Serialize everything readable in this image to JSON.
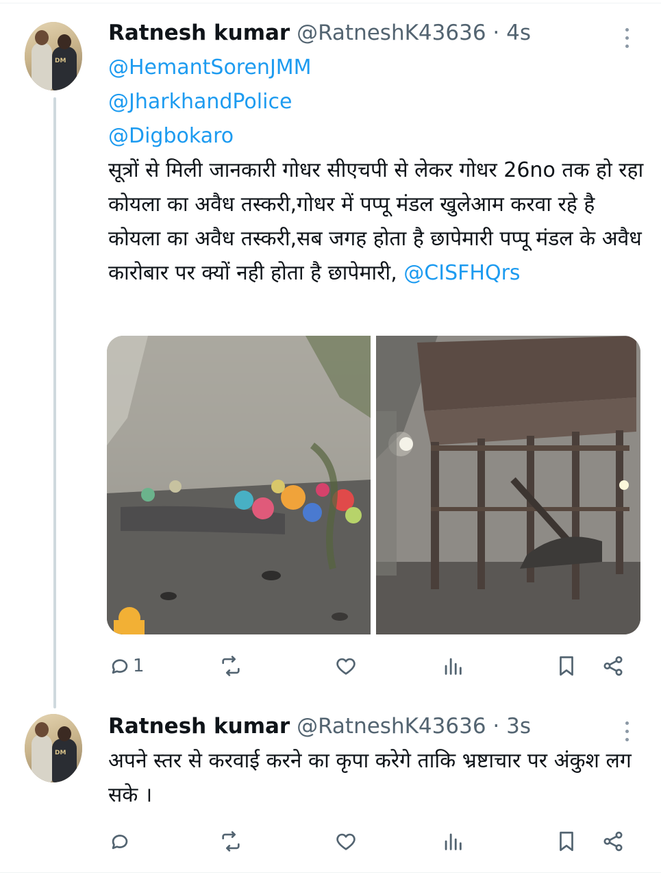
{
  "tweets": [
    {
      "name": "Ratnesh kumar",
      "handle": "@RatneshK43636",
      "time": "4s",
      "mentions": [
        "@HemantSorenJMM",
        "@JharkhandPolice",
        "@Digbokaro"
      ],
      "text": "सूत्रों से मिली जानकारी गोधर सीएचपी से लेकर गोधर 26no तक हो रहा कोयला का अवैध तस्करी,गोधर में पप्पू मंडल खुलेआम करवा रहे है कोयला का अवैध तस्करी,सब जगह होता है छापेमारी पप्पू मंडल के अवैध कारोबार पर क्यों नही होता है छापेमारी,",
      "trailing_mention": "@CISFHQrs",
      "reply_count": "1"
    },
    {
      "name": "Ratnesh kumar",
      "handle": "@RatneshK43636",
      "time": "3s",
      "text": "अपने स्तर से करवाई करने का कृपा करेगे ताकि भ्रष्टाचार पर अंकुश लग सके ।",
      "reply_count": ""
    }
  ],
  "separator": " · ",
  "icons": {
    "reply": "reply-icon",
    "retweet": "retweet-icon",
    "like": "heart-icon",
    "views": "views-icon",
    "bookmark": "bookmark-icon",
    "share": "share-icon",
    "more": "more-vertical-icon"
  },
  "colors": {
    "link": "#1d9bf0",
    "muted": "#536471",
    "thread_line": "#cfd9de"
  }
}
